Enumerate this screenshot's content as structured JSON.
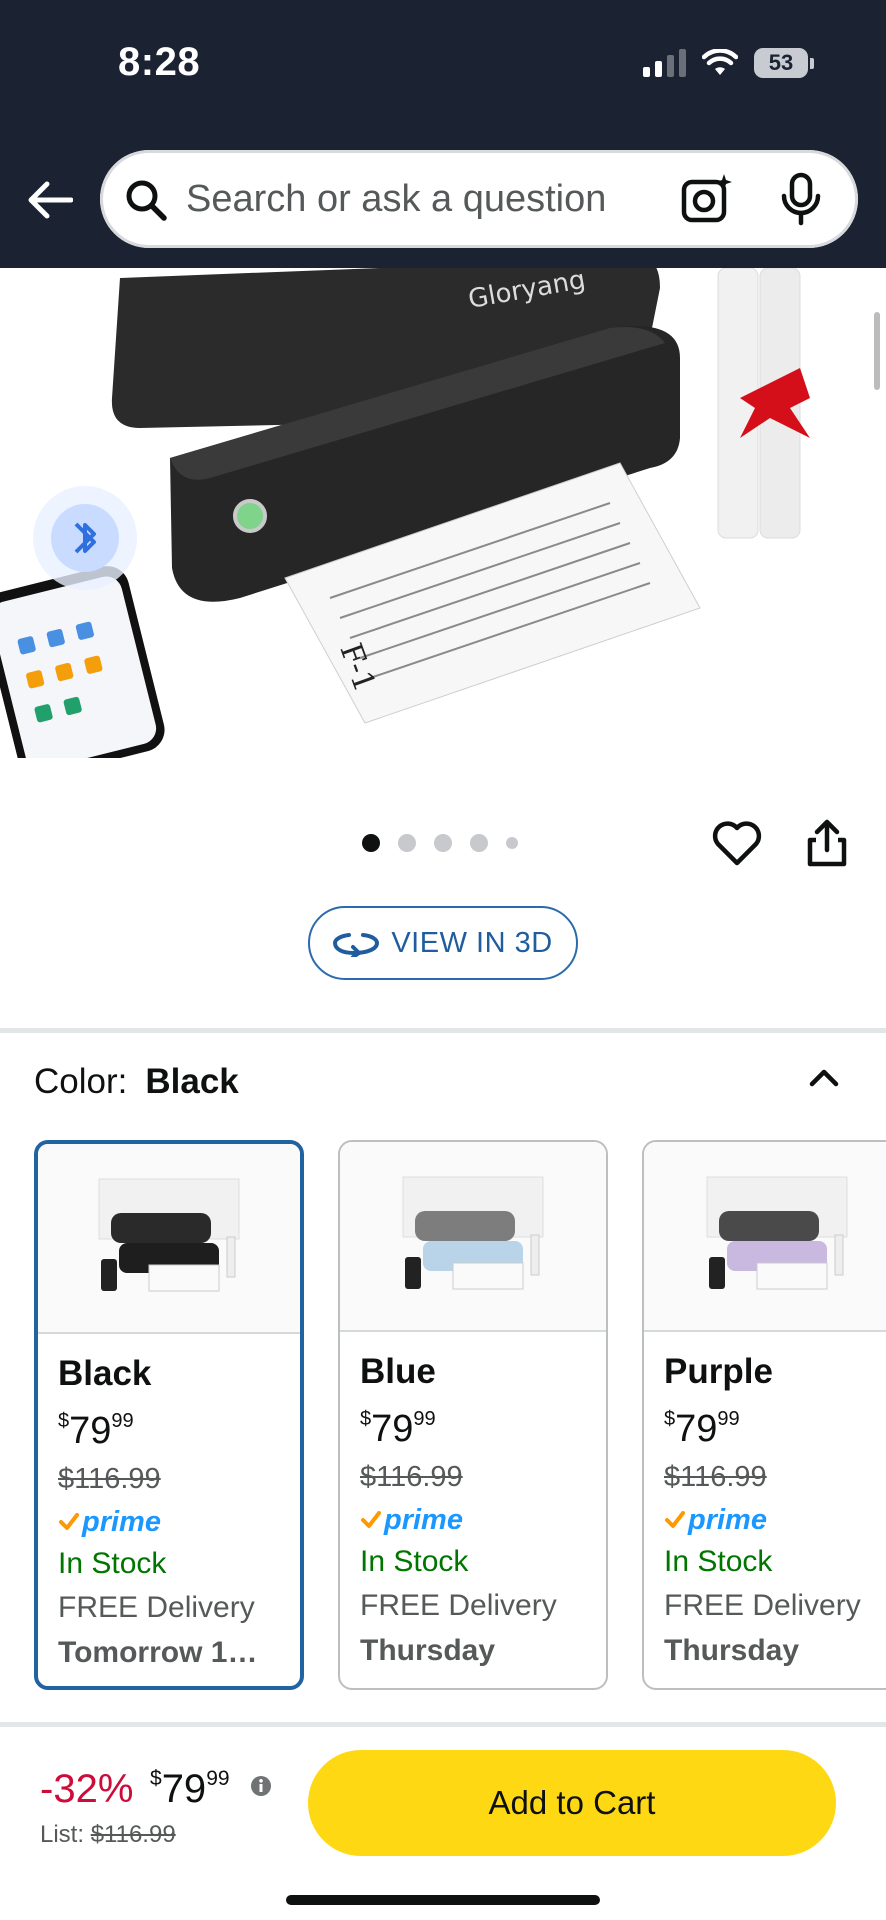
{
  "status_bar": {
    "time": "8:28",
    "battery": "53"
  },
  "search": {
    "placeholder": "Search or ask a question"
  },
  "product_image": {
    "brand_text": "Gloryang",
    "doc_text": "F-1"
  },
  "carousel": {
    "total": 5,
    "active": 1
  },
  "view3d": {
    "label": "VIEW IN 3D"
  },
  "color": {
    "label": "Color:",
    "selected": "Black"
  },
  "variants": [
    {
      "name": "Black",
      "price_whole": "79",
      "price_cents": "99",
      "currency": "$",
      "list_price": "$116.99",
      "prime": "prime",
      "stock": "In Stock",
      "delivery": "FREE Delivery",
      "date": "Tomorrow 1…",
      "swatch": "#2a2a2a"
    },
    {
      "name": "Blue",
      "price_whole": "79",
      "price_cents": "99",
      "currency": "$",
      "list_price": "$116.99",
      "prime": "prime",
      "stock": "In Stock",
      "delivery": "FREE Delivery",
      "date": "Thursday",
      "swatch": "#b9d4e8"
    },
    {
      "name": "Purple",
      "price_whole": "79",
      "price_cents": "99",
      "currency": "$",
      "list_price": "$116.99",
      "prime": "prime",
      "stock": "In Stock",
      "delivery": "FREE Delivery",
      "date": "Thursday",
      "swatch": "#c9b8df"
    }
  ],
  "bottom_bar": {
    "discount": "-32%",
    "currency": "$",
    "price_whole": "79",
    "price_cents": "99",
    "list_label": "List:",
    "list_price": "$116.99",
    "cta": "Add to Cart"
  },
  "colors": {
    "header": "#1b2232",
    "cta": "#ffd814",
    "link": "#2162a1",
    "deal": "#cc0c39",
    "stock": "#007600",
    "prime": "#1a98ff"
  }
}
